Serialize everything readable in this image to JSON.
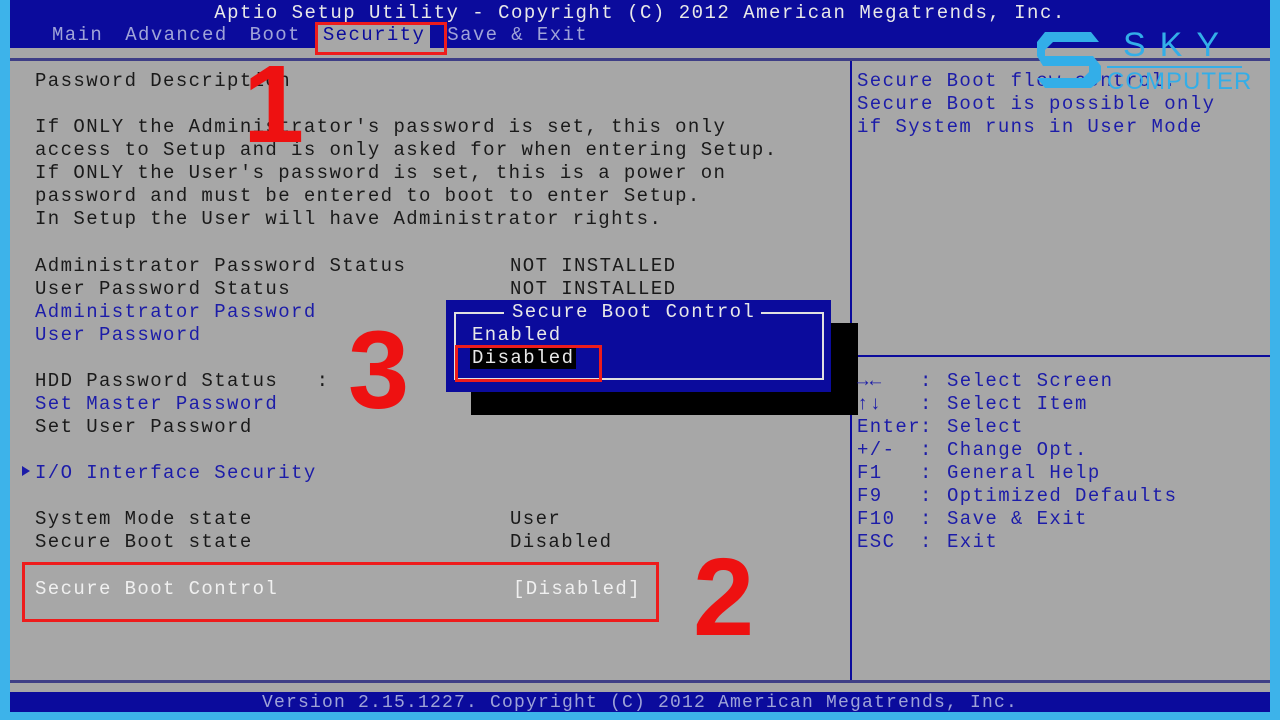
{
  "header": {
    "title": "Aptio Setup Utility - Copyright (C) 2012 American Megatrends, Inc.",
    "tabs": [
      {
        "label": "Main"
      },
      {
        "label": "Advanced"
      },
      {
        "label": "Boot"
      },
      {
        "label": "Security",
        "active": true
      },
      {
        "label": "Save & Exit"
      }
    ]
  },
  "main": {
    "description_title": "Password Description",
    "description": [
      "If ONLY the Administrator's password is set, this only",
      "access to Setup and is only asked for when entering Setup.",
      "If ONLY the User's password is set, this is a power on",
      "password and must be entered to boot to enter Setup.",
      "In Setup the User will have Administrator rights."
    ],
    "admin_status_label": "Administrator Password Status",
    "admin_status_value": "NOT INSTALLED",
    "user_status_label": "User Password Status",
    "user_status_value": "NOT INSTALLED",
    "admin_password": "Administrator Password",
    "user_password": "User Password",
    "hdd_status_label": "HDD Password Status   :",
    "set_master": "Set Master Password",
    "set_user": "Set User Password",
    "io_security": "I/O Interface Security",
    "system_mode_label": "System Mode state",
    "system_mode_value": "User",
    "secure_boot_state_label": "Secure Boot state",
    "secure_boot_state_value": "Disabled",
    "secure_boot_control_label": "Secure Boot Control",
    "secure_boot_control_value": "[Disabled]"
  },
  "popup": {
    "title": "Secure Boot Control",
    "options": [
      {
        "label": "Enabled"
      },
      {
        "label": "Disabled",
        "selected": true
      }
    ]
  },
  "help": {
    "lines": [
      "Secure Boot flow control.",
      "Secure Boot is possible only",
      "if System runs in User Mode"
    ]
  },
  "keys": [
    {
      "key": "→←",
      "desc": "Select Screen"
    },
    {
      "key": "↑↓",
      "desc": "Select Item"
    },
    {
      "key": "Enter",
      "desc": "Select"
    },
    {
      "key": "+/-",
      "desc": "Change Opt."
    },
    {
      "key": "F1",
      "desc": "General Help"
    },
    {
      "key": "F9",
      "desc": "Optimized Defaults"
    },
    {
      "key": "F10",
      "desc": "Save & Exit"
    },
    {
      "key": "ESC",
      "desc": "Exit"
    }
  ],
  "footer": "Version 2.15.1227. Copyright (C) 2012 American Megatrends, Inc.",
  "annotations": [
    "1",
    "2",
    "3"
  ],
  "logo": {
    "line1": "SKY",
    "line2": "COMPUTER"
  },
  "colors": {
    "bios_blue": "#0b0b9c",
    "bios_gray": "#a7a7a7",
    "annotation_red": "#ee1c1c",
    "frame": "#3db3ea"
  }
}
